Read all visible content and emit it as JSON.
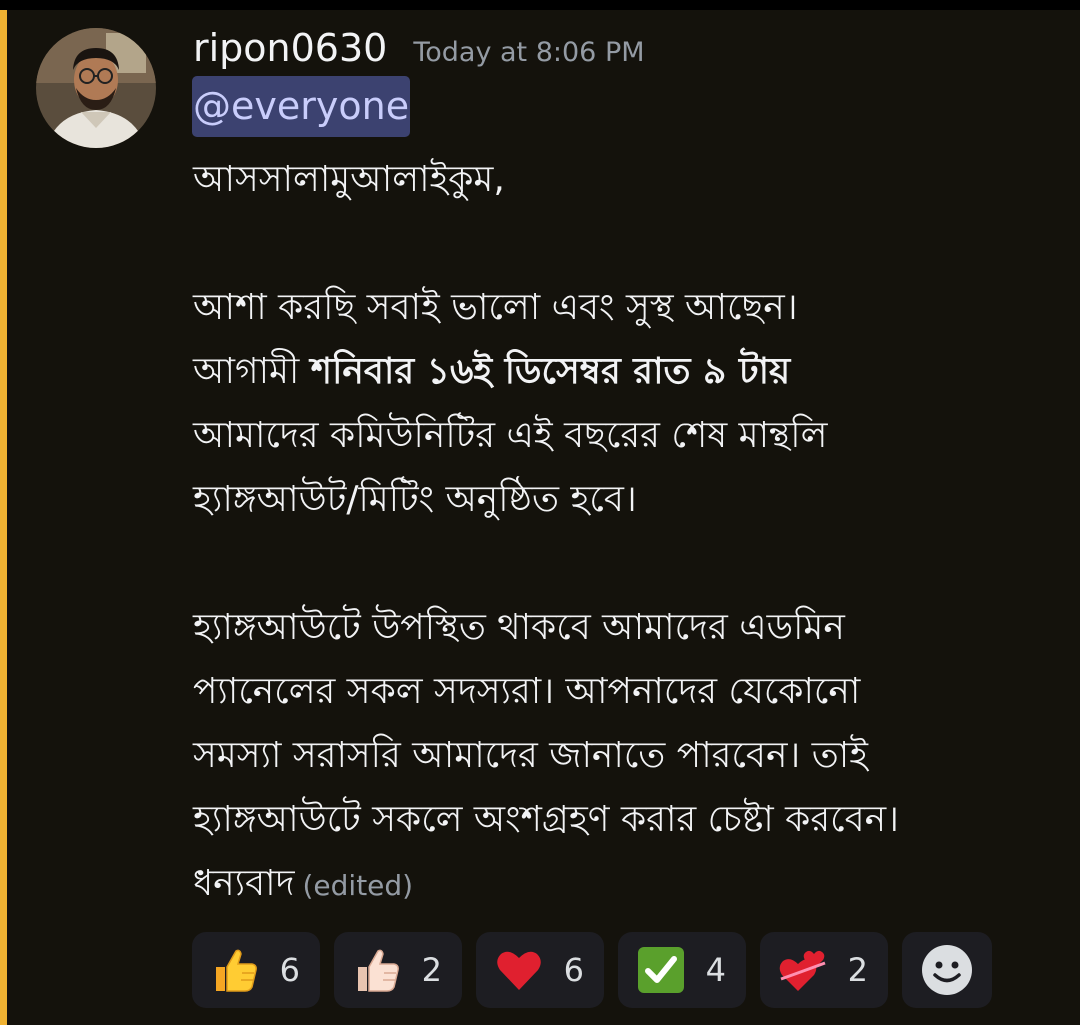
{
  "message": {
    "author": "ripon0630",
    "timestamp": "Today at 8:06 PM",
    "mention": "@everyone",
    "greeting": "আসসালামুআলাইকুম,",
    "line1": "আশা করছি সবাই ভালো এবং সুস্থ আছেন।",
    "line2_prefix": "আগামী ",
    "line2_bold": "শনিবার ১৬ই  ডিসেম্বর রাত ৯ টায়",
    "line3": "আমাদের কমিউনিটির এই বছরের শেষ মান্থলি",
    "line4": "হ্যাঙ্গআউট/মিটিং অনুষ্ঠিত হবে।",
    "line5": "হ্যাঙ্গআউটে উপস্থিত থাকবে আমাদের এডমিন",
    "line6": "প্যানেলের সকল সদস্যরা। আপনাদের যেকোনো",
    "line7": "সমস্যা সরাসরি আমাদের জানাতে পারবেন। তাই",
    "line8": "হ্যাঙ্গআউটে সকলে অংশগ্রহণ করার চেষ্টা করবেন।",
    "closing": "ধন্যবাদ",
    "edited_label": "(edited)"
  },
  "reactions": [
    {
      "icon": "thumbs-up-yellow",
      "count": "6"
    },
    {
      "icon": "thumbs-up-light",
      "count": "2"
    },
    {
      "icon": "red-heart",
      "count": "6"
    },
    {
      "icon": "green-check",
      "count": "4"
    },
    {
      "icon": "hearts-ribbon",
      "count": "2"
    }
  ],
  "add_reaction_icon": "smiley-add",
  "colors": {
    "background": "#14120c",
    "highlight": "#f0b232",
    "mention_bg": "#3c4270",
    "mention_text": "#c9cdfb",
    "muted_text": "#949ba4"
  }
}
